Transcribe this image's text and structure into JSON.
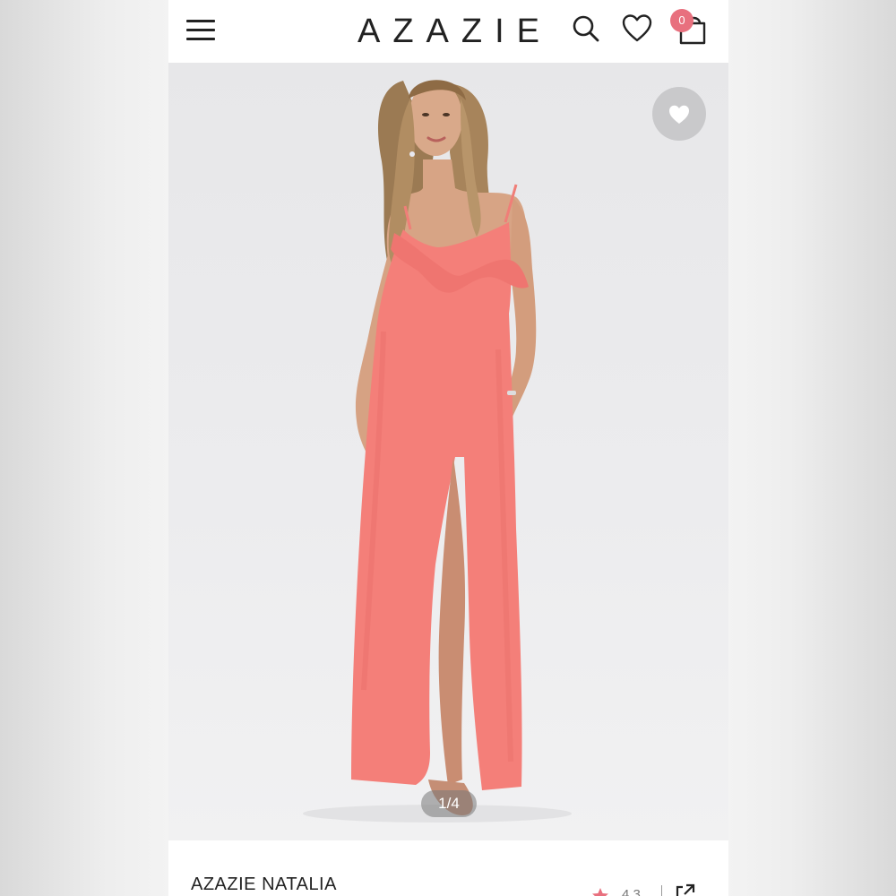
{
  "header": {
    "brand": "AZAZIE",
    "cart_count": "0"
  },
  "icons": {
    "menu": "hamburger-menu-icon",
    "search": "search-icon",
    "wishlist": "heart-icon",
    "cart": "shopping-bag-icon",
    "favorite": "heart-icon",
    "share": "share-icon",
    "star": "star-icon"
  },
  "gallery": {
    "pager": "1/4"
  },
  "product": {
    "name": "AZAZIE NATALIA",
    "rating": "4.3"
  },
  "colors": {
    "dress": "#f47f79",
    "badge": "#e8707e",
    "star": "#e8707e",
    "text": "#222222"
  }
}
